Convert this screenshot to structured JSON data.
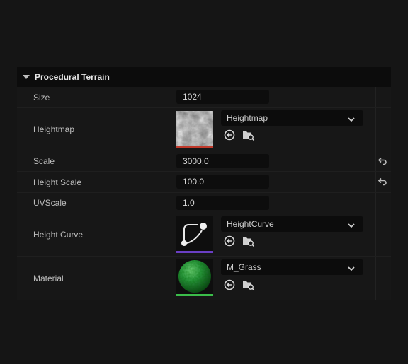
{
  "panel": {
    "title": "Procedural Terrain",
    "rows": {
      "size": {
        "label": "Size",
        "value": "1024"
      },
      "heightmap": {
        "label": "Heightmap",
        "asset": "Heightmap"
      },
      "scale": {
        "label": "Scale",
        "value": "3000.0"
      },
      "height_scale": {
        "label": "Height Scale",
        "value": "100.0"
      },
      "uvscale": {
        "label": "UVScale",
        "value": "1.0"
      },
      "height_curve": {
        "label": "Height Curve",
        "asset": "HeightCurve"
      },
      "material": {
        "label": "Material",
        "asset": "M_Grass"
      }
    }
  },
  "colors": {
    "texture_bar": "#c0392b",
    "curve_bar": "#6a3fc4",
    "material_bar": "#3bbd4a"
  },
  "icons": [
    "collapse-caret-icon",
    "reset-arrow-icon",
    "chevron-down-icon",
    "use-selected-icon",
    "browse-asset-icon"
  ]
}
